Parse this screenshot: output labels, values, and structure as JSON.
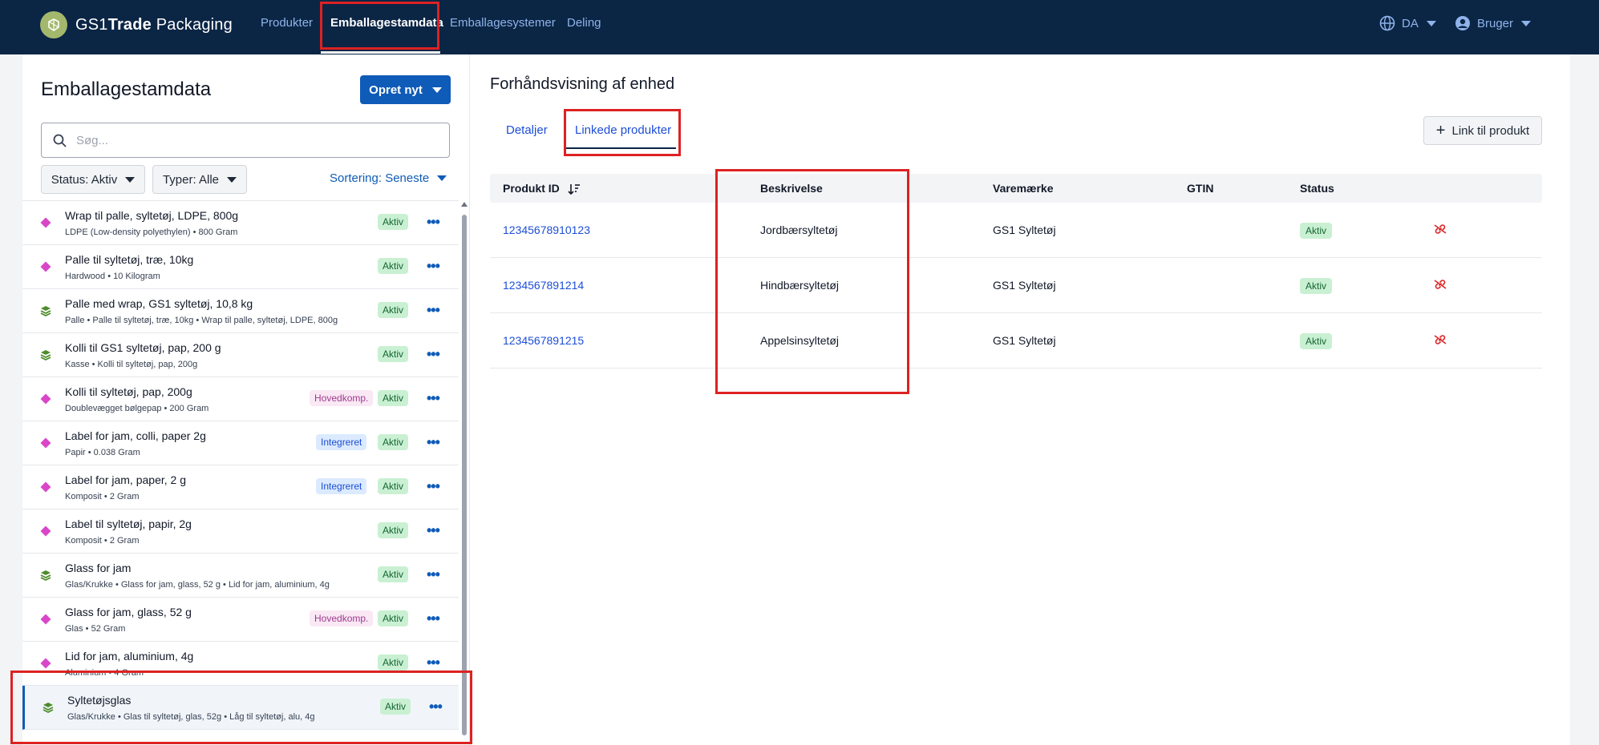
{
  "nav": {
    "brand_gs1": "GS1",
    "brand_trade": "Trade",
    "brand_rest": " Packaging",
    "items": [
      "Produkter",
      "Emballagestamdata",
      "Emballagesystemer",
      "Deling"
    ],
    "language": "DA",
    "user": "Bruger"
  },
  "left": {
    "title": "Emballagestamdata",
    "create_button": "Opret nyt",
    "search_placeholder": "Søg...",
    "filter_status": "Status: Aktiv",
    "filter_types": "Typer: Alle",
    "sort": "Sortering: Seneste",
    "items": [
      {
        "icon": "diamond-icon",
        "name": "Wrap til palle, syltetøj, LDPE, 800g",
        "sub": "LDPE (Low-density polyethylen) • 800 Gram",
        "tag": "",
        "status": "Aktiv"
      },
      {
        "icon": "diamond-icon",
        "name": "Palle til syltetøj, træ, 10kg",
        "sub": "Hardwood • 10 Kilogram",
        "tag": "",
        "status": "Aktiv"
      },
      {
        "icon": "layers-icon",
        "name": "Palle med wrap, GS1 syltetøj, 10,8 kg",
        "sub": "Palle • Palle til syltetøj, træ, 10kg • Wrap til palle, syltetøj, LDPE, 800g",
        "tag": "",
        "status": "Aktiv"
      },
      {
        "icon": "layers-icon",
        "name": "Kolli til GS1 syltetøj, pap, 200 g",
        "sub": "Kasse • Kolli til syltetøj, pap, 200g",
        "tag": "",
        "status": "Aktiv"
      },
      {
        "icon": "diamond-icon",
        "name": "Kolli til syltetøj, pap, 200g",
        "sub": "Doublevægget bølgepap • 200 Gram",
        "tag": "Hovedkomp.",
        "status": "Aktiv"
      },
      {
        "icon": "diamond-icon",
        "name": "Label for jam, colli, paper 2g",
        "sub": "Papir • 0.038 Gram",
        "tag": "Integreret",
        "status": "Aktiv"
      },
      {
        "icon": "diamond-icon",
        "name": "Label for jam, paper, 2 g",
        "sub": "Komposit • 2 Gram",
        "tag": "Integreret",
        "status": "Aktiv"
      },
      {
        "icon": "diamond-icon",
        "name": "Label til syltetøj, papir, 2g",
        "sub": "Komposit • 2 Gram",
        "tag": "",
        "status": "Aktiv"
      },
      {
        "icon": "layers-icon",
        "name": "Glass for jam",
        "sub": "Glas/Krukke • Glass for jam, glass, 52 g • Lid for jam, aluminium, 4g",
        "tag": "",
        "status": "Aktiv"
      },
      {
        "icon": "diamond-icon",
        "name": "Glass for jam, glass, 52 g",
        "sub": "Glas • 52 Gram",
        "tag": "Hovedkomp.",
        "status": "Aktiv"
      },
      {
        "icon": "diamond-icon",
        "name": "Lid for jam, aluminium, 4g",
        "sub": "Aluminium • 4 Gram",
        "tag": "",
        "status": "Aktiv"
      },
      {
        "icon": "layers-icon",
        "name": "Syltetøjsglas",
        "sub": "Glas/Krukke • Glas til syltetøj, glas, 52g • Låg til syltetøj, alu, 4g",
        "tag": "",
        "status": "Aktiv"
      }
    ]
  },
  "right": {
    "title": "Forhåndsvisning af enhed",
    "tabs": [
      "Detaljer",
      "Linkede produkter"
    ],
    "link_button": "Link til produkt",
    "columns": [
      "Produkt ID",
      "Beskrivelse",
      "Varemærke",
      "GTIN",
      "Status"
    ],
    "rows": [
      {
        "id": "12345678910123",
        "desc": "Jordbærsyltetøj",
        "brand": "GS1 Syltetøj",
        "gtin": "",
        "status": "Aktiv"
      },
      {
        "id": "1234567891214",
        "desc": "Hindbærsyltetøj",
        "brand": "GS1 Syltetøj",
        "gtin": "",
        "status": "Aktiv"
      },
      {
        "id": "1234567891215",
        "desc": "Appelsinsyltetøj",
        "brand": "GS1 Syltetøj",
        "gtin": "",
        "status": "Aktiv"
      }
    ]
  },
  "colors": {
    "nav_bg": "#0b2545",
    "accent": "#0f5bb8",
    "aktiv_bg": "#c9f0d2",
    "highlight": "#dd2222"
  }
}
